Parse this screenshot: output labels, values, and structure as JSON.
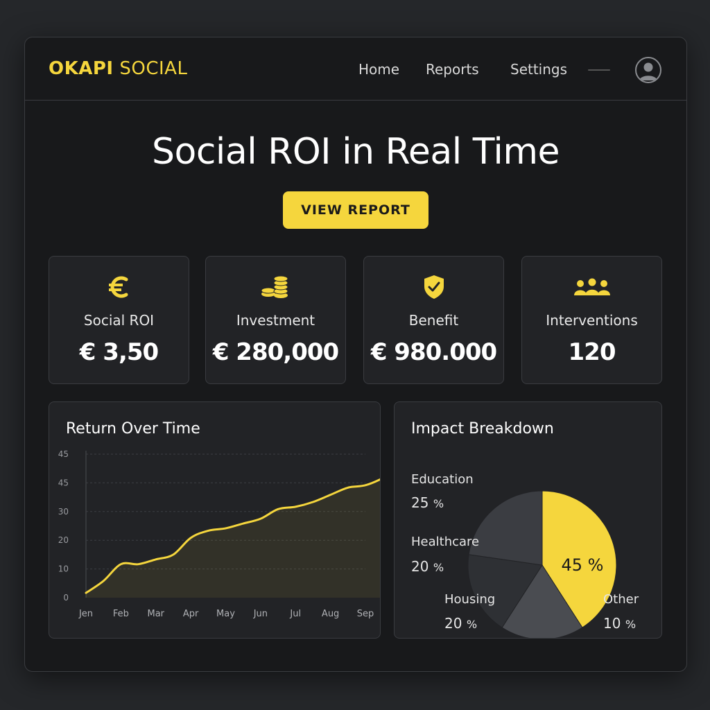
{
  "app": {
    "brand_bold": "OKAPI",
    "brand_light": "SOCIAL"
  },
  "nav": {
    "items": [
      {
        "label": "Home"
      },
      {
        "label": "Reports"
      },
      {
        "label": "Settings"
      }
    ],
    "avatar_icon": "user-avatar-icon"
  },
  "hero": {
    "title": "Social ROI in Real Time",
    "cta_label": "VIEW REPORT"
  },
  "colors": {
    "accent": "#f5d63d",
    "background": "#18191b",
    "card": "#222326"
  },
  "metrics": [
    {
      "icon": "euro-icon",
      "label": "Social ROI",
      "value": "€ 3,50"
    },
    {
      "icon": "coins-icon",
      "label": "Investment",
      "value": "€ 280,000"
    },
    {
      "icon": "shield-check-icon",
      "label": "Benefit",
      "value": "€ 980.000"
    },
    {
      "icon": "people-group-icon",
      "label": "Interventions",
      "value": "120"
    }
  ],
  "line_panel": {
    "title": "Return Over Time"
  },
  "pie_panel": {
    "title": "Impact Breakdown",
    "slices": [
      {
        "label": "Education",
        "pct_num": "25",
        "pct_unit": "%"
      },
      {
        "label": "Healthcare",
        "pct_num": "20",
        "pct_unit": "%"
      },
      {
        "label": "Housing",
        "pct_num": "20",
        "pct_unit": "%"
      },
      {
        "label": "Other",
        "pct_num": "10",
        "pct_unit": "%"
      }
    ],
    "center_label": "45 %"
  },
  "chart_data": [
    {
      "type": "line",
      "title": "Return Over Time",
      "categories": [
        "Jen",
        "Feb",
        "Mar",
        "Apr",
        "May",
        "Jun",
        "Jul",
        "Aug",
        "Sep"
      ],
      "y_ticks": [
        "0",
        "10",
        "20",
        "30",
        "45",
        "45"
      ],
      "x": [
        0,
        0.5,
        1,
        1.5,
        2,
        2.5,
        3,
        3.5,
        4,
        4.5,
        5,
        5.5,
        6,
        6.5,
        7,
        7.5,
        8,
        8.5,
        8.95
      ],
      "values": [
        2,
        7,
        14,
        14,
        16,
        18,
        25,
        28,
        29,
        31,
        33,
        37,
        38,
        40,
        43,
        46,
        47,
        50,
        54
      ],
      "ylim": [
        0,
        60
      ],
      "grid": true,
      "line_color": "#f5d63d"
    },
    {
      "type": "pie",
      "title": "Impact Breakdown",
      "slices": [
        {
          "name": "45 %",
          "value": 45,
          "color": "#f5d63d"
        },
        {
          "name": "Housing",
          "value": 20,
          "color": "#4a4c51"
        },
        {
          "name": "Healthcare",
          "value": 20,
          "color": "#2e3034"
        },
        {
          "name": "Education",
          "value": 25,
          "color": "#3b3d42"
        }
      ]
    }
  ]
}
